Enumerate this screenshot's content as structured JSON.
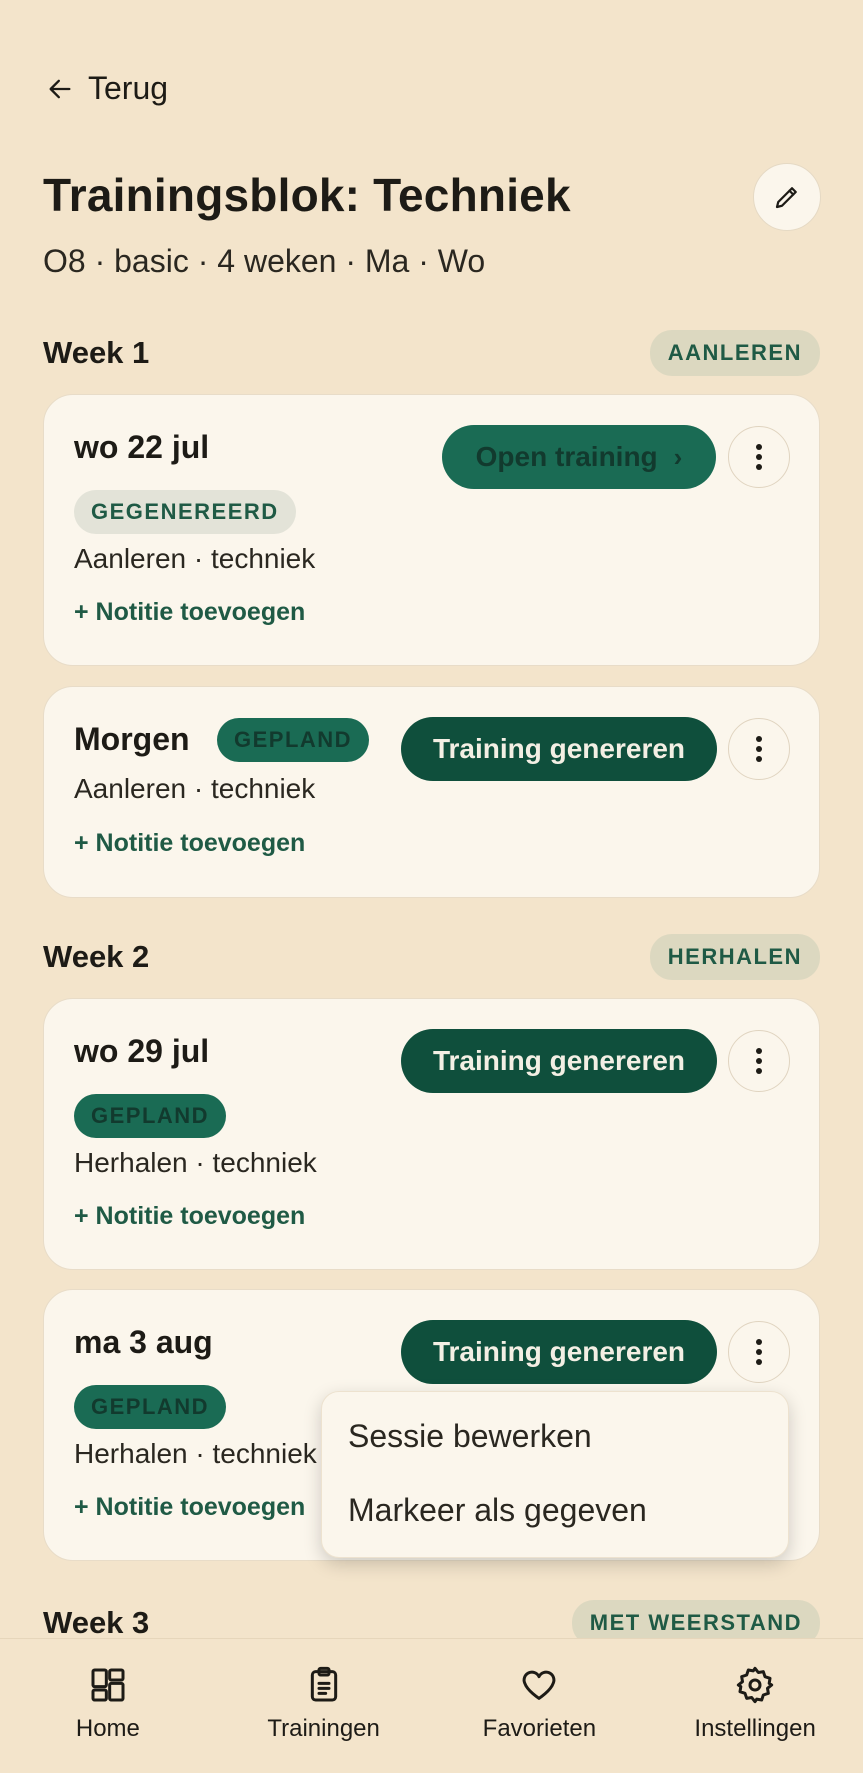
{
  "header": {
    "back_label": "Terug",
    "title": "Trainingsblok: Techniek",
    "subtitle": "O8 · basic · 4 weken · Ma · Wo"
  },
  "weeks": [
    {
      "title": "Week 1",
      "phase": "AANLEREN",
      "sessions": [
        {
          "date": "wo 22 jul",
          "status": "GEGENEREERD",
          "description": "Aanleren · techniek",
          "note_label": "+ Notitie toevoegen",
          "action_label": "Open training",
          "action_chevron": "›"
        },
        {
          "date": "Morgen",
          "status": "GEPLAND",
          "description": "Aanleren · techniek",
          "note_label": "+ Notitie toevoegen",
          "action_label": "Training genereren"
        }
      ]
    },
    {
      "title": "Week 2",
      "phase": "HERHALEN",
      "sessions": [
        {
          "date": "wo 29 jul",
          "status": "GEPLAND",
          "description": "Herhalen · techniek",
          "note_label": "+ Notitie toevoegen",
          "action_label": "Training genereren"
        },
        {
          "date": "ma 3 aug",
          "status": "GEPLAND",
          "description": "Herhalen · techniek",
          "note_label": "+ Notitie toevoegen",
          "action_label": "Training genereren"
        }
      ]
    },
    {
      "title": "Week 3",
      "phase": "MET WEERSTAND"
    }
  ],
  "context_menu": {
    "items": [
      "Sessie bewerken",
      "Markeer als gegeven"
    ]
  },
  "bottom_nav": [
    {
      "label": "Home",
      "icon": "grid-icon"
    },
    {
      "label": "Trainingen",
      "icon": "clipboard-icon"
    },
    {
      "label": "Favorieten",
      "icon": "heart-icon"
    },
    {
      "label": "Instellingen",
      "icon": "gear-icon"
    }
  ],
  "colors": {
    "background": "#f3e4cb",
    "card": "#fbf6ec",
    "accent_dark": "#0f4f3c",
    "accent": "#1a6b54",
    "badge": "#dcd8c0"
  }
}
